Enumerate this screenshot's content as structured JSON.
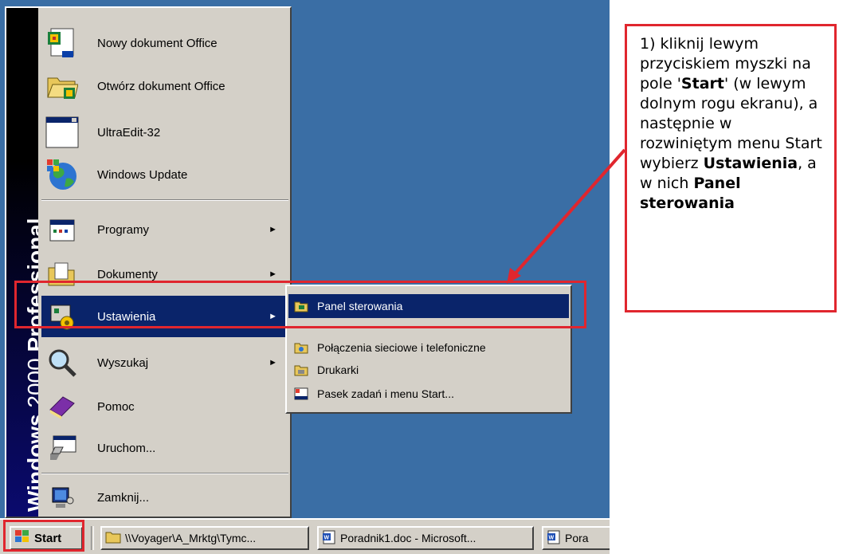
{
  "start_menu": {
    "banner": [
      "Windows",
      "2000",
      "Professional"
    ],
    "items": [
      {
        "label": "Nowy dokument Office",
        "icon": "new-office-document-icon",
        "arrow": false
      },
      {
        "label": "Otwórz dokument Office",
        "icon": "open-office-document-icon",
        "arrow": false
      },
      {
        "label": "UltraEdit-32",
        "icon": "ultraedit-icon",
        "arrow": false
      },
      {
        "label": "Windows Update",
        "icon": "windows-update-globe-icon",
        "arrow": false
      },
      {
        "label": "Programy",
        "icon": "programs-folder-icon",
        "arrow": true
      },
      {
        "label": "Dokumenty",
        "icon": "documents-folder-icon",
        "arrow": true
      },
      {
        "label": "Ustawienia",
        "icon": "settings-icon",
        "arrow": true,
        "selected": true
      },
      {
        "label": "Wyszukaj",
        "icon": "search-magnifier-icon",
        "arrow": true
      },
      {
        "label": "Pomoc",
        "icon": "help-book-icon",
        "arrow": false
      },
      {
        "label": "Uruchom...",
        "icon": "run-icon",
        "arrow": false
      },
      {
        "label": "Zamknij...",
        "icon": "shutdown-icon",
        "arrow": false
      }
    ],
    "arrow_glyph": "►"
  },
  "submenu": {
    "items": [
      {
        "label": "Panel sterowania",
        "icon": "control-panel-icon",
        "selected": true
      },
      {
        "label": "Połączenia sieciowe i telefoniczne",
        "icon": "network-connections-icon"
      },
      {
        "label": "Drukarki",
        "icon": "printers-icon"
      },
      {
        "label": "Pasek zadań i menu Start...",
        "icon": "taskbar-start-menu-icon"
      }
    ]
  },
  "taskbar": {
    "start_label": "Start",
    "buttons": [
      {
        "label": "\\\\Voyager\\A_Mrktg\\Tymc...",
        "icon": "folder-icon"
      },
      {
        "label": "Poradnik1.doc - Microsoft...",
        "icon": "word-document-icon"
      },
      {
        "label": "Pora",
        "icon": "word-document-icon"
      }
    ]
  },
  "callout": {
    "p1": "1) kliknij lewym przyciskiem myszki na pole '",
    "b1": "Start",
    "p2": "' (w lewym dolnym rogu ekranu), a następnie w rozwiniętym menu Start wybierz ",
    "b2": "Ustawienia",
    "p3": ", a w nich ",
    "b3": "Panel sterowania"
  },
  "colors": {
    "desktop": "#3a6ea5",
    "menu_face": "#d4d0c8",
    "selection": "#0a246a",
    "highlight_red": "#e0262e"
  }
}
